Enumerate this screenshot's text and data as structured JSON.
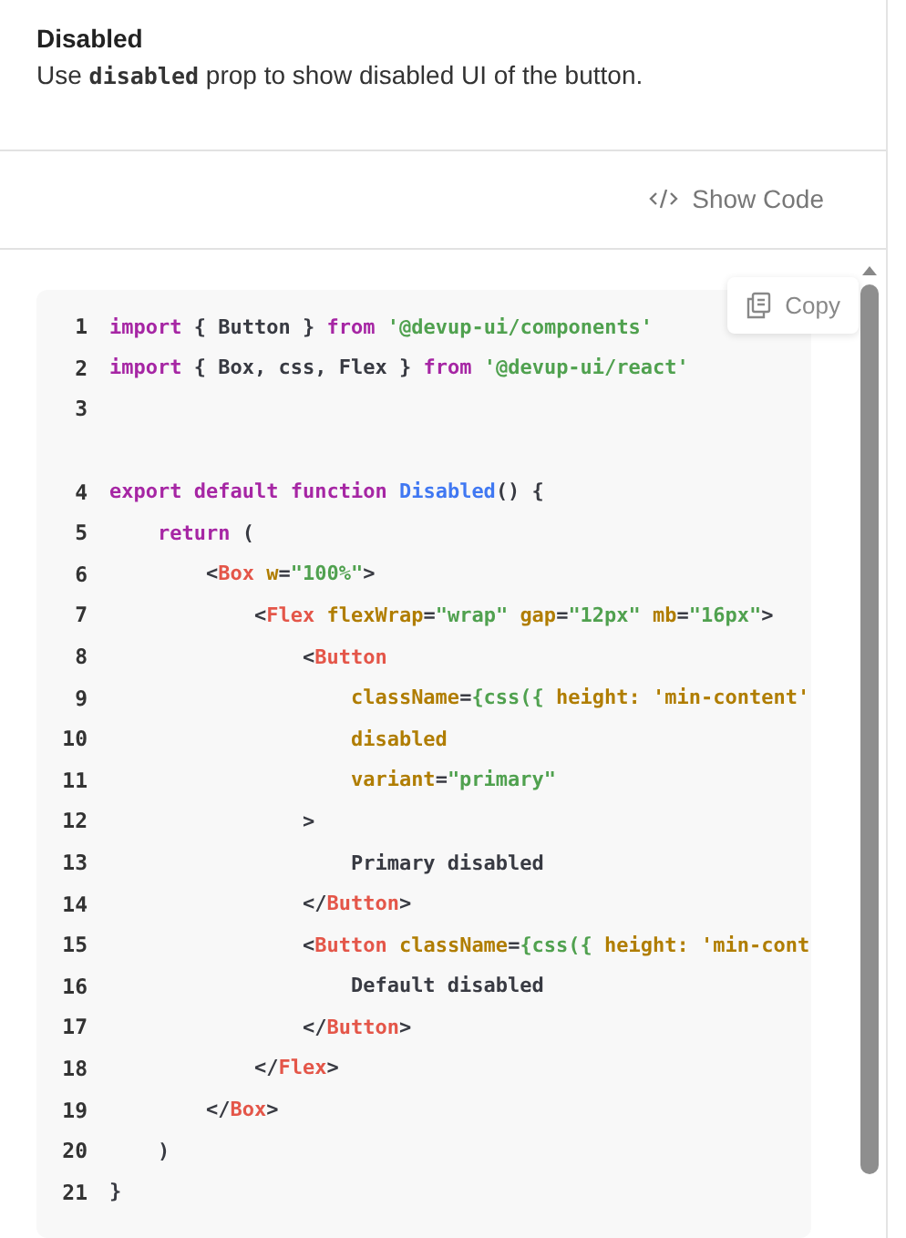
{
  "section": {
    "title": "Disabled",
    "description": {
      "before": "Use ",
      "code": "disabled",
      "after": " prop to show disabled UI of the button."
    }
  },
  "show_code_button": {
    "label": "Show Code"
  },
  "copy_button": {
    "label": "Copy"
  },
  "code": {
    "lines": [
      {
        "number": "1",
        "tokens": [
          {
            "kind": "keyword",
            "t": "import"
          },
          {
            "kind": "plain",
            "t": " { Button } "
          },
          {
            "kind": "keyword",
            "t": "from "
          },
          {
            "kind": "string",
            "t": "'@devup-ui/components'"
          }
        ]
      },
      {
        "number": "2",
        "tokens": [
          {
            "kind": "keyword",
            "t": "import"
          },
          {
            "kind": "plain",
            "t": " { Box, css, Flex } "
          },
          {
            "kind": "keyword",
            "t": "from "
          },
          {
            "kind": "string",
            "t": "'@devup-ui/react'"
          }
        ]
      },
      {
        "number": "3"
      },
      {
        "number": "4",
        "gap_before": true,
        "tokens": [
          {
            "kind": "keyword",
            "t": "export default function "
          },
          {
            "kind": "function",
            "t": "Disabled"
          },
          {
            "kind": "plain",
            "t": "() {"
          }
        ]
      },
      {
        "number": "5",
        "tokens": [
          {
            "kind": "keyword",
            "t": "    return"
          },
          {
            "kind": "plain",
            "t": " ("
          }
        ]
      },
      {
        "number": "6",
        "tokens": [
          {
            "kind": "plain",
            "t": "        <"
          },
          {
            "kind": "tag",
            "t": "Box "
          },
          {
            "kind": "attr",
            "t": "w"
          },
          {
            "kind": "plain",
            "t": "="
          },
          {
            "kind": "string",
            "t": "\"100%\""
          },
          {
            "kind": "plain",
            "t": ">"
          }
        ]
      },
      {
        "number": "7",
        "tokens": [
          {
            "kind": "plain",
            "t": "            <"
          },
          {
            "kind": "tag",
            "t": "Flex "
          },
          {
            "kind": "attr",
            "t": "flexWrap"
          },
          {
            "kind": "plain",
            "t": "="
          },
          {
            "kind": "string",
            "t": "\"wrap\" "
          },
          {
            "kind": "attr",
            "t": "gap"
          },
          {
            "kind": "plain",
            "t": "="
          },
          {
            "kind": "string",
            "t": "\"12px\" "
          },
          {
            "kind": "attr",
            "t": "mb"
          },
          {
            "kind": "plain",
            "t": "="
          },
          {
            "kind": "string",
            "t": "\"16px\""
          },
          {
            "kind": "plain",
            "t": ">"
          }
        ]
      },
      {
        "number": "8",
        "tokens": [
          {
            "kind": "plain",
            "t": "                <"
          },
          {
            "kind": "tag",
            "t": "Button"
          }
        ]
      },
      {
        "number": "9",
        "tokens": [
          {
            "kind": "attr",
            "t": "                    className"
          },
          {
            "kind": "plain",
            "t": "="
          },
          {
            "kind": "string",
            "t": "{css({ "
          },
          {
            "kind": "attr",
            "t": "height: 'min-content'"
          }
        ]
      },
      {
        "number": "10",
        "tokens": [
          {
            "kind": "attr",
            "t": "                    disabled"
          }
        ]
      },
      {
        "number": "11",
        "tokens": [
          {
            "kind": "attr",
            "t": "                    variant"
          },
          {
            "kind": "plain",
            "t": "="
          },
          {
            "kind": "string",
            "t": "\"primary\""
          }
        ]
      },
      {
        "number": "12",
        "tokens": [
          {
            "kind": "plain",
            "t": "                >"
          }
        ]
      },
      {
        "number": "13",
        "tokens": [
          {
            "kind": "plain",
            "t": "                    Primary disabled"
          }
        ]
      },
      {
        "number": "14",
        "tokens": [
          {
            "kind": "plain",
            "t": "                </"
          },
          {
            "kind": "tag",
            "t": "Button"
          },
          {
            "kind": "plain",
            "t": ">"
          }
        ]
      },
      {
        "number": "15",
        "tokens": [
          {
            "kind": "plain",
            "t": "                <"
          },
          {
            "kind": "tag",
            "t": "Button "
          },
          {
            "kind": "attr",
            "t": "className"
          },
          {
            "kind": "plain",
            "t": "="
          },
          {
            "kind": "string",
            "t": "{css({ "
          },
          {
            "kind": "attr",
            "t": "height: 'min-cont"
          }
        ]
      },
      {
        "number": "16",
        "tokens": [
          {
            "kind": "plain",
            "t": "                    Default disabled"
          }
        ]
      },
      {
        "number": "17",
        "tokens": [
          {
            "kind": "plain",
            "t": "                </"
          },
          {
            "kind": "tag",
            "t": "Button"
          },
          {
            "kind": "plain",
            "t": ">"
          }
        ]
      },
      {
        "number": "18",
        "tokens": [
          {
            "kind": "plain",
            "t": "            </"
          },
          {
            "kind": "tag",
            "t": "Flex"
          },
          {
            "kind": "plain",
            "t": ">"
          }
        ]
      },
      {
        "number": "19",
        "tokens": [
          {
            "kind": "plain",
            "t": "        </"
          },
          {
            "kind": "tag",
            "t": "Box"
          },
          {
            "kind": "plain",
            "t": ">"
          }
        ]
      },
      {
        "number": "20",
        "tokens": [
          {
            "kind": "plain",
            "t": "    )"
          }
        ]
      },
      {
        "number": "21",
        "tokens": [
          {
            "kind": "plain",
            "t": "}"
          }
        ]
      }
    ]
  }
}
